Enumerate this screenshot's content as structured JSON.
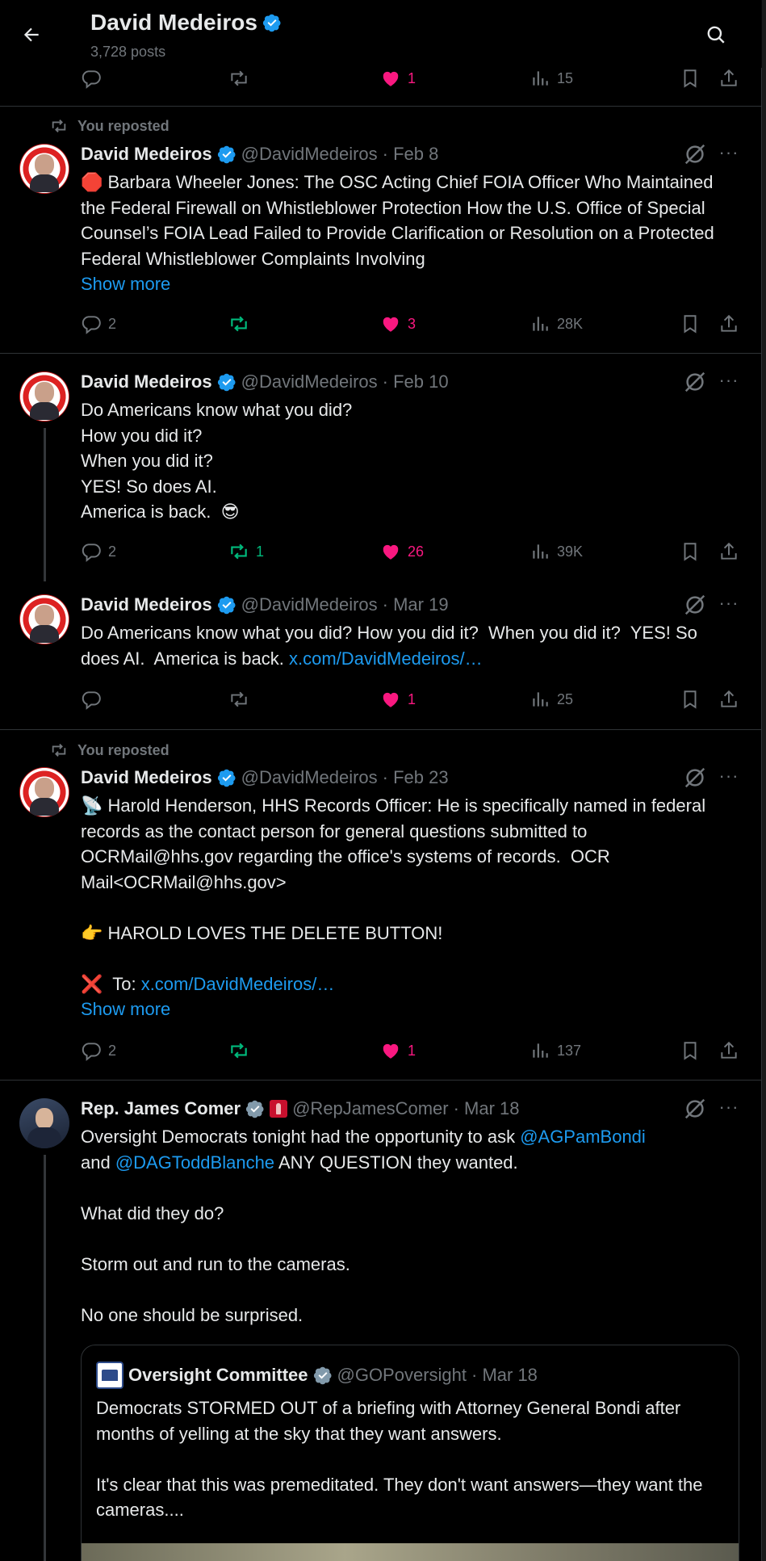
{
  "header": {
    "name": "David Medeiros",
    "posts_count": "3,728 posts"
  },
  "colors": {
    "accent": "#1d9bf0",
    "like": "#f91880",
    "repost": "#00ba7c",
    "muted": "#71767b"
  },
  "top_actions": {
    "reply": "",
    "repost": "",
    "like": "1",
    "views": "15"
  },
  "posts": [
    {
      "repost_label": "You reposted",
      "name": "David Medeiros",
      "handle": "@DavidMedeiros",
      "date": "· Feb 8",
      "text": "🛑 Barbara Wheeler Jones: The OSC Acting Chief FOIA Officer Who Maintained the Federal Firewall on Whistleblower Protection How the U.S. Office of Special Counsel’s FOIA Lead Failed to Provide Clarification or Resolution on a Protected Federal Whistleblower Complaints Involving",
      "show_more": "Show more",
      "reply": "2",
      "repost": "",
      "like": "3",
      "views": "28K"
    },
    {
      "name": "David Medeiros",
      "handle": "@DavidMedeiros",
      "date": "· Feb 10",
      "text": "Do Americans know what you did?\nHow you did it?\nWhen you did it?\nYES! So does AI.\nAmerica is back.  😎",
      "reply": "2",
      "repost": "1",
      "like": "26",
      "views": "39K"
    },
    {
      "name": "David Medeiros",
      "handle": "@DavidMedeiros",
      "date": "· Mar 19",
      "text": "Do Americans know what you did? How you did it?  When you did it?  YES! So does AI.  America is back. ",
      "link": "x.com/DavidMedeiros/…",
      "reply": "",
      "repost": "",
      "like": "1",
      "views": "25"
    },
    {
      "repost_label": "You reposted",
      "name": "David Medeiros",
      "handle": "@DavidMedeiros",
      "date": "· Feb 23",
      "text": "📡 Harold Henderson, HHS Records Officer: He is specifically named in federal records as the contact person for general questions submitted to OCRMail@hhs.gov regarding the office's systems of records.  OCR Mail<OCRMail@hhs.gov>\n\n👉 HAROLD LOVES THE DELETE BUTTON!\n\n❌  To: ",
      "link": "x.com/DavidMedeiros/…",
      "show_more": "Show more",
      "reply": "2",
      "repost": "",
      "like": "1",
      "views": "137"
    },
    {
      "name": "Rep. James Comer",
      "handle": "@RepJamesComer",
      "date": "· Mar 18",
      "text_a": "Oversight Democrats tonight had the opportunity to ask ",
      "mention_1": "@AGPamBondi",
      "text_b": "\nand ",
      "mention_2": "@DAGToddBlanche",
      "text_c": " ANY QUESTION they wanted.\n\nWhat did they do?\n\nStorm out and run to the cameras.\n\nNo one should be surprised."
    }
  ],
  "quote": {
    "name": "Oversight Committee",
    "handle": "@GOPoversight",
    "date": "· Mar 18",
    "text": "Democrats STORMED OUT of a briefing with Attorney General Bondi after months of yelling at the sky that they want answers.\n\nIt's clear that this was premeditated. They don't want answers—they want the cameras...."
  }
}
